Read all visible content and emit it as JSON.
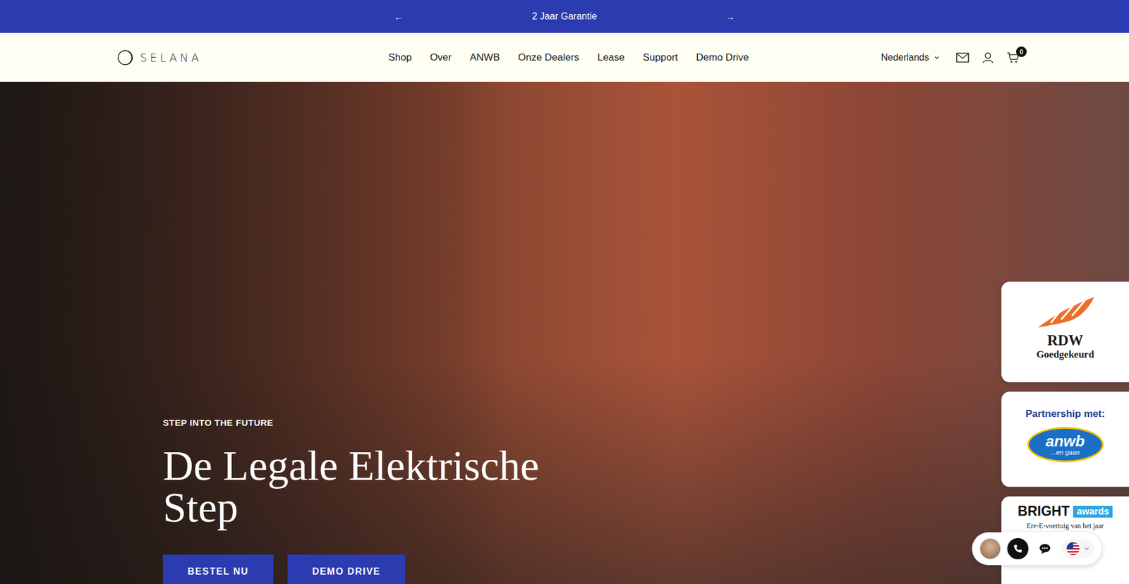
{
  "announcement": {
    "prev": "←",
    "text": "2 Jaar Garantie",
    "next": "→"
  },
  "header": {
    "logo": "SELANA",
    "nav": [
      {
        "label": "Shop"
      },
      {
        "label": "Over"
      },
      {
        "label": "ANWB"
      },
      {
        "label": "Onze Dealers"
      },
      {
        "label": "Lease"
      },
      {
        "label": "Support"
      },
      {
        "label": "Demo Drive"
      }
    ],
    "language": "Nederlands",
    "cart_count": "0"
  },
  "hero": {
    "eyebrow": "STEP INTO THE FUTURE",
    "title": "De Legale Elektrische Step",
    "buttons": [
      "BESTEL NU",
      "DEMO DRIVE"
    ]
  },
  "badges": [
    {
      "kind": "rdw",
      "title": "RDW",
      "subtitle": "Goedgekeurd"
    },
    {
      "kind": "anwb",
      "heading": "Partnership met:",
      "logo": "anwb",
      "tagline": "...en gaan"
    },
    {
      "kind": "bright",
      "logo": "BRIGHT",
      "tag": "awards",
      "caption": "Ere-E-voertuig van het jaar"
    }
  ]
}
